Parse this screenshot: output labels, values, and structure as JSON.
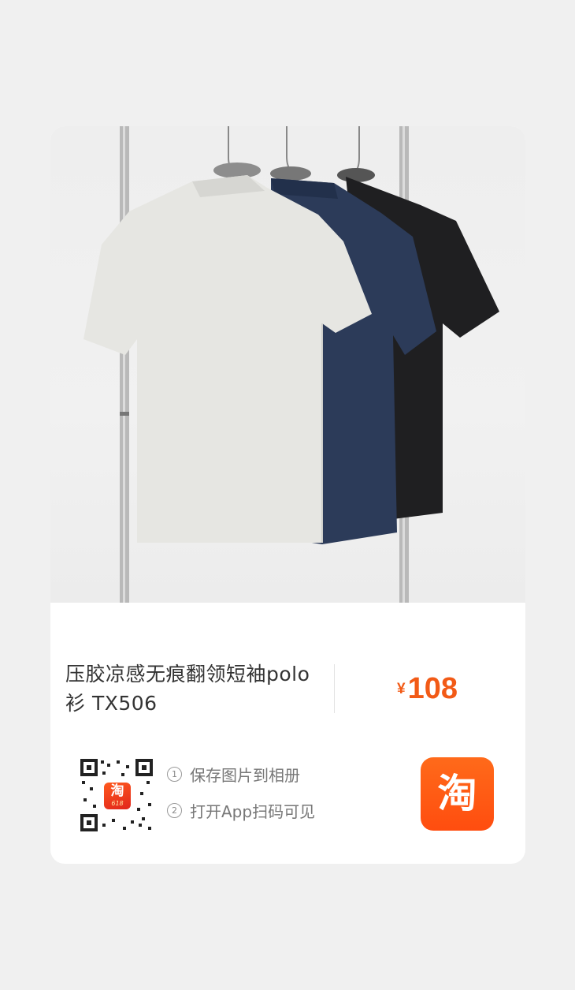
{
  "product": {
    "title_line1": "压胶凉感无痕翻领短袖polo",
    "title_line2": "衫 TX506",
    "price_symbol": "¥",
    "price_value": "108",
    "shirt_colors": [
      "#e6e6e2",
      "#2c3b59",
      "#1f1f21"
    ]
  },
  "share": {
    "step1_num": "1",
    "step1_text": "保存图片到相册",
    "step2_num": "2",
    "step2_text": "打开App扫码可见",
    "qr_logo_char": "淘",
    "qr_logo_sub": "618",
    "app_logo_char": "淘"
  },
  "colors": {
    "accent": "#f25a16",
    "taobao_orange": "#ff5410"
  }
}
